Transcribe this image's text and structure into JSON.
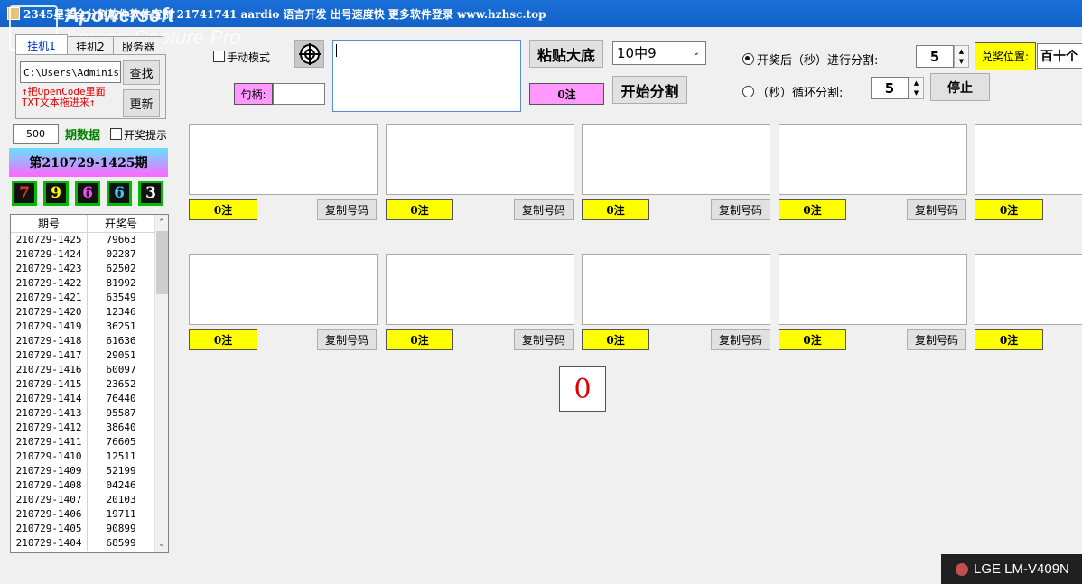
{
  "window": {
    "title": "2345星荟全分割软件软件定制 21741741 aardio 语言开发 出号速度快 更多软件登录 www.hzhsc.top"
  },
  "watermark": {
    "line1": "Apowersoft",
    "line2": "Screen Capture Pro"
  },
  "tabs": [
    {
      "label": "挂机1",
      "active": true
    },
    {
      "label": "挂机2",
      "active": false
    },
    {
      "label": "服务器",
      "active": false
    }
  ],
  "left_panel": {
    "path_value": "C:\\Users\\Administ",
    "find_label": "查找",
    "update_label": "更新",
    "note_line1": "↑把OpenCode里面",
    "note_line2": "TXT文本拖进来↑",
    "period_count": "500",
    "period_label": "期数据",
    "draw_hint_label": "开奖提示",
    "current_period": "第210729-1425期",
    "digits": [
      {
        "value": "7",
        "color": "#ff2a2a"
      },
      {
        "value": "9",
        "color": "#ffff00"
      },
      {
        "value": "6",
        "color": "#ff44ff"
      },
      {
        "value": "6",
        "color": "#33ccff"
      },
      {
        "value": "3",
        "color": "#ffffff"
      }
    ],
    "table_headers": [
      "期号",
      "开奖号"
    ],
    "rows": [
      [
        "210729-1425",
        "79663"
      ],
      [
        "210729-1424",
        "02287"
      ],
      [
        "210729-1423",
        "62502"
      ],
      [
        "210729-1422",
        "81992"
      ],
      [
        "210729-1421",
        "63549"
      ],
      [
        "210729-1420",
        "12346"
      ],
      [
        "210729-1419",
        "36251"
      ],
      [
        "210729-1418",
        "61636"
      ],
      [
        "210729-1417",
        "29051"
      ],
      [
        "210729-1416",
        "60097"
      ],
      [
        "210729-1415",
        "23652"
      ],
      [
        "210729-1414",
        "76440"
      ],
      [
        "210729-1413",
        "95587"
      ],
      [
        "210729-1412",
        "38640"
      ],
      [
        "210729-1411",
        "76605"
      ],
      [
        "210729-1410",
        "12511"
      ],
      [
        "210729-1409",
        "52199"
      ],
      [
        "210729-1408",
        "04246"
      ],
      [
        "210729-1407",
        "20103"
      ],
      [
        "210729-1406",
        "19711"
      ],
      [
        "210729-1405",
        "90899"
      ],
      [
        "210729-1404",
        "68599"
      ]
    ]
  },
  "controls": {
    "manual_mode_label": "手动模式",
    "handle_label": "句柄:",
    "handle_value": "",
    "main_text_value": "",
    "paste_button": "粘贴大底",
    "count_badge": "0注",
    "select_value": "10中9",
    "start_split_button": "开始分割",
    "radio_after_draw_label": "开奖后（秒）进行分割:",
    "radio_after_draw_value": "5",
    "radio_loop_label": "（秒）循环分割:",
    "radio_loop_value": "5",
    "stop_button": "停止",
    "prize_position_label": "兑奖位置:",
    "prize_position_value": "百十个"
  },
  "split_panels": {
    "count_label": "0注",
    "copy_label": "复制号码"
  },
  "center_counter": "0",
  "device_badge": "LGE LM-V409N"
}
